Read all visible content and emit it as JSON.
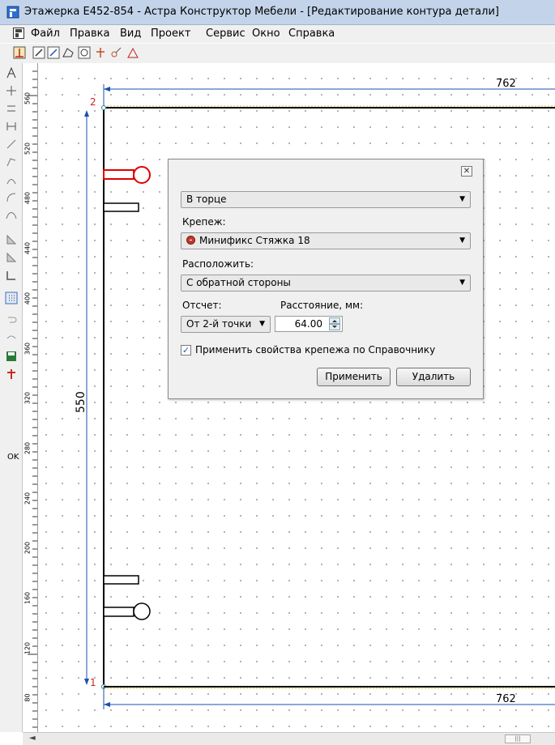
{
  "window": {
    "title": "Этажерка Е452-854 - Астра Конструктор Мебели - [Редактирование контура детали]"
  },
  "menu": [
    "Файл",
    "Правка",
    "Вид",
    "Проект",
    "Сервис",
    "Окно",
    "Справка"
  ],
  "toolbar_icons": [
    "contour-tool-icon",
    "edit-line-icon",
    "edit-line-2-icon",
    "polygon-icon",
    "circle-arc-icon",
    "fastener-icon",
    "drill-icon",
    "triangle-icon"
  ],
  "left_tools": {
    "ok_label": "OK"
  },
  "ruler": {
    "labels": [
      "560",
      "520",
      "480",
      "440",
      "400",
      "360",
      "320",
      "280",
      "240",
      "200",
      "160",
      "120",
      "80"
    ]
  },
  "drawing": {
    "dimension_top": "762",
    "dimension_bottom": "762",
    "dimension_vertical": "550",
    "point_top": "2",
    "point_bottom": "1",
    "accent_line_color": "#1a4fb0",
    "point_color": "#d02020",
    "fastener_highlight_color": "#e00000"
  },
  "dialog": {
    "position_value": "В торце",
    "fastener_label": "Крепеж:",
    "fastener_value": "Минификс Стяжка 18",
    "place_label": "Расположить:",
    "place_value": "С обратной стороны",
    "count_label": "Отсчет:",
    "count_value": "От 2-й точки",
    "distance_label": "Расстояние, мм:",
    "distance_value": "64.00",
    "apply_props_label": "Применить свойства крепежа по Справочнику",
    "apply_props_checked": true,
    "apply_button": "Применить",
    "delete_button": "Удалить"
  }
}
